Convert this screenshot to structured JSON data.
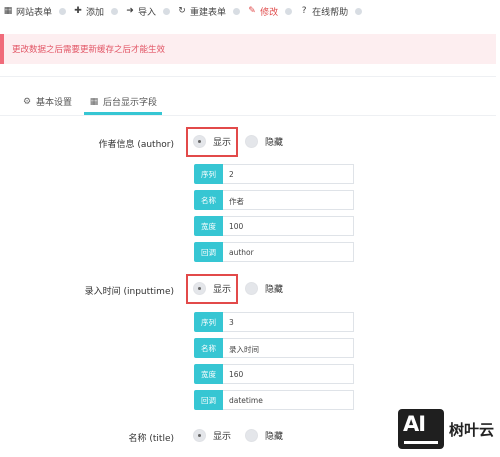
{
  "toolbar": {
    "items": [
      {
        "label": "网站表单",
        "icon": "table-icon"
      },
      {
        "label": "添加",
        "icon": "plus-icon"
      },
      {
        "label": "导入",
        "icon": "sign-in-icon"
      },
      {
        "label": "重建表单",
        "icon": "refresh-icon"
      },
      {
        "label": "修改",
        "icon": "edit-icon"
      },
      {
        "label": "在线帮助",
        "icon": "question-circle-icon"
      }
    ]
  },
  "notice": "更改数据之后需要更新缓存之后才能生效",
  "tabs": {
    "basic": "基本设置",
    "display_fields": "后台显示字段"
  },
  "fields": [
    {
      "label": "作者信息 (author)",
      "show": "显示",
      "hide": "隐藏",
      "order_label": "序列",
      "order": "2",
      "name_label": "名称",
      "name": "作者",
      "width_label": "宽度",
      "width": "100",
      "callback_label": "回调",
      "callback": "author"
    },
    {
      "label": "录入时间 (inputtime)",
      "show": "显示",
      "hide": "隐藏",
      "order_label": "序列",
      "order": "3",
      "name_label": "名称",
      "name": "录入时间",
      "width_label": "宽度",
      "width": "160",
      "callback_label": "回调",
      "callback": "datetime"
    },
    {
      "label": "名称 (title)",
      "show": "显示",
      "hide": "隐藏"
    }
  ],
  "watermark": {
    "text": "树叶云",
    "logo_letters": "AI"
  },
  "colors": {
    "accent": "#36c6d3",
    "notice_text": "#e25565",
    "highlight": "#e24a4a"
  }
}
